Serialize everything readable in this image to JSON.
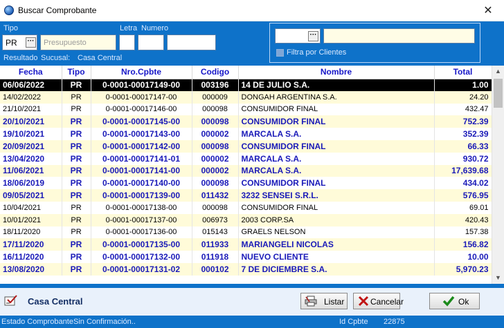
{
  "window": {
    "title": "Buscar Comprobante",
    "close_glyph": "✕"
  },
  "filters": {
    "tipo_label": "Tipo",
    "tipo_value": "PR",
    "tipo_desc_placeholder": "Presupuesto",
    "letra_label": "Letra",
    "numero_label": "Numero",
    "resultado_label": "Resultado",
    "sucursal_label": "Sucusal:",
    "sucursal_value": "Casa Central",
    "client_code_value": "",
    "client_name_value": "",
    "filtra_label": "Filtra por Clientes",
    "filtra_checked": false
  },
  "grid": {
    "columns": [
      "Fecha",
      "Tipo",
      "Nro.Cpbte",
      "Codigo",
      "Nombre",
      "Total"
    ],
    "rows": [
      {
        "fecha": "06/06/2022",
        "tipo": "PR",
        "nro": "0-0001-00017149-00",
        "codigo": "003196",
        "nombre": "14 DE JULIO S.A.",
        "total": "1.00",
        "state": "selected"
      },
      {
        "fecha": "14/02/2022",
        "tipo": "PR",
        "nro": "0-0001-00017147-00",
        "codigo": "000009",
        "nombre": "DONGAH ARGENTINA S.A.",
        "total": "24.20",
        "state": "normal"
      },
      {
        "fecha": "21/10/2021",
        "tipo": "PR",
        "nro": "0-0001-00017146-00",
        "codigo": "000098",
        "nombre": "CONSUMIDOR FINAL",
        "total": "432.47",
        "state": "normal"
      },
      {
        "fecha": "20/10/2021",
        "tipo": "PR",
        "nro": "0-0001-00017145-00",
        "codigo": "000098",
        "nombre": "CONSUMIDOR FINAL",
        "total": "752.39",
        "state": "confirmed"
      },
      {
        "fecha": "19/10/2021",
        "tipo": "PR",
        "nro": "0-0001-00017143-00",
        "codigo": "000002",
        "nombre": "MARCALA S.A.",
        "total": "352.39",
        "state": "confirmed"
      },
      {
        "fecha": "20/09/2021",
        "tipo": "PR",
        "nro": "0-0001-00017142-00",
        "codigo": "000098",
        "nombre": "CONSUMIDOR FINAL",
        "total": "66.33",
        "state": "confirmed"
      },
      {
        "fecha": "13/04/2020",
        "tipo": "PR",
        "nro": "0-0001-00017141-01",
        "codigo": "000002",
        "nombre": "MARCALA S.A.",
        "total": "930.72",
        "state": "confirmed"
      },
      {
        "fecha": "11/06/2021",
        "tipo": "PR",
        "nro": "0-0001-00017141-00",
        "codigo": "000002",
        "nombre": "MARCALA S.A.",
        "total": "17,639.68",
        "state": "confirmed"
      },
      {
        "fecha": "18/06/2019",
        "tipo": "PR",
        "nro": "0-0001-00017140-00",
        "codigo": "000098",
        "nombre": "CONSUMIDOR FINAL",
        "total": "434.02",
        "state": "confirmed"
      },
      {
        "fecha": "09/05/2021",
        "tipo": "PR",
        "nro": "0-0001-00017139-00",
        "codigo": "011432",
        "nombre": "3232 SENSEI S.R.L.",
        "total": "576.95",
        "state": "confirmed"
      },
      {
        "fecha": "10/04/2021",
        "tipo": "PR",
        "nro": "0-0001-00017138-00",
        "codigo": "000098",
        "nombre": "CONSUMIDOR FINAL",
        "total": "69.01",
        "state": "normal"
      },
      {
        "fecha": "10/01/2021",
        "tipo": "PR",
        "nro": "0-0001-00017137-00",
        "codigo": "006973",
        "nombre": "2003 CORP.SA",
        "total": "420.43",
        "state": "normal"
      },
      {
        "fecha": "18/11/2020",
        "tipo": "PR",
        "nro": "0-0001-00017136-00",
        "codigo": "015143",
        "nombre": "GRAELS NELSON",
        "total": "157.38",
        "state": "normal"
      },
      {
        "fecha": "17/11/2020",
        "tipo": "PR",
        "nro": "0-0001-00017135-00",
        "codigo": "011933",
        "nombre": "MARIANGELI NICOLAS",
        "total": "156.82",
        "state": "confirmed"
      },
      {
        "fecha": "16/11/2020",
        "tipo": "PR",
        "nro": "0-0001-00017132-00",
        "codigo": "011918",
        "nombre": "NUEVO CLIENTE",
        "total": "10.00",
        "state": "confirmed"
      },
      {
        "fecha": "13/08/2020",
        "tipo": "PR",
        "nro": "0-0001-00017131-02",
        "codigo": "000102",
        "nombre": "7 DE DICIEMBRE S.A.",
        "total": "5,970.23",
        "state": "confirmed"
      }
    ]
  },
  "bottom": {
    "branch_name": "Casa Central",
    "listar_label": "Listar",
    "cancelar_label": "Cancelar",
    "ok_label": "Ok"
  },
  "status": {
    "estado_label": "Estado Comprobante",
    "estado_value": "Sin Confirmación..",
    "id_label": "Id Cpbte",
    "id_value": "22875"
  },
  "colors": {
    "panel_blue": "#0e72c9",
    "header_text": "#1616c8",
    "confirmed_text": "#1a1ab8",
    "alt_row": "#fffbd9"
  },
  "icons": {
    "app": "globe-icon",
    "lookup": "ellipsis-icon",
    "branch": "pencil-tag-icon",
    "listar": "printer-icon",
    "cancelar": "x-icon",
    "ok": "checkmark-icon"
  }
}
